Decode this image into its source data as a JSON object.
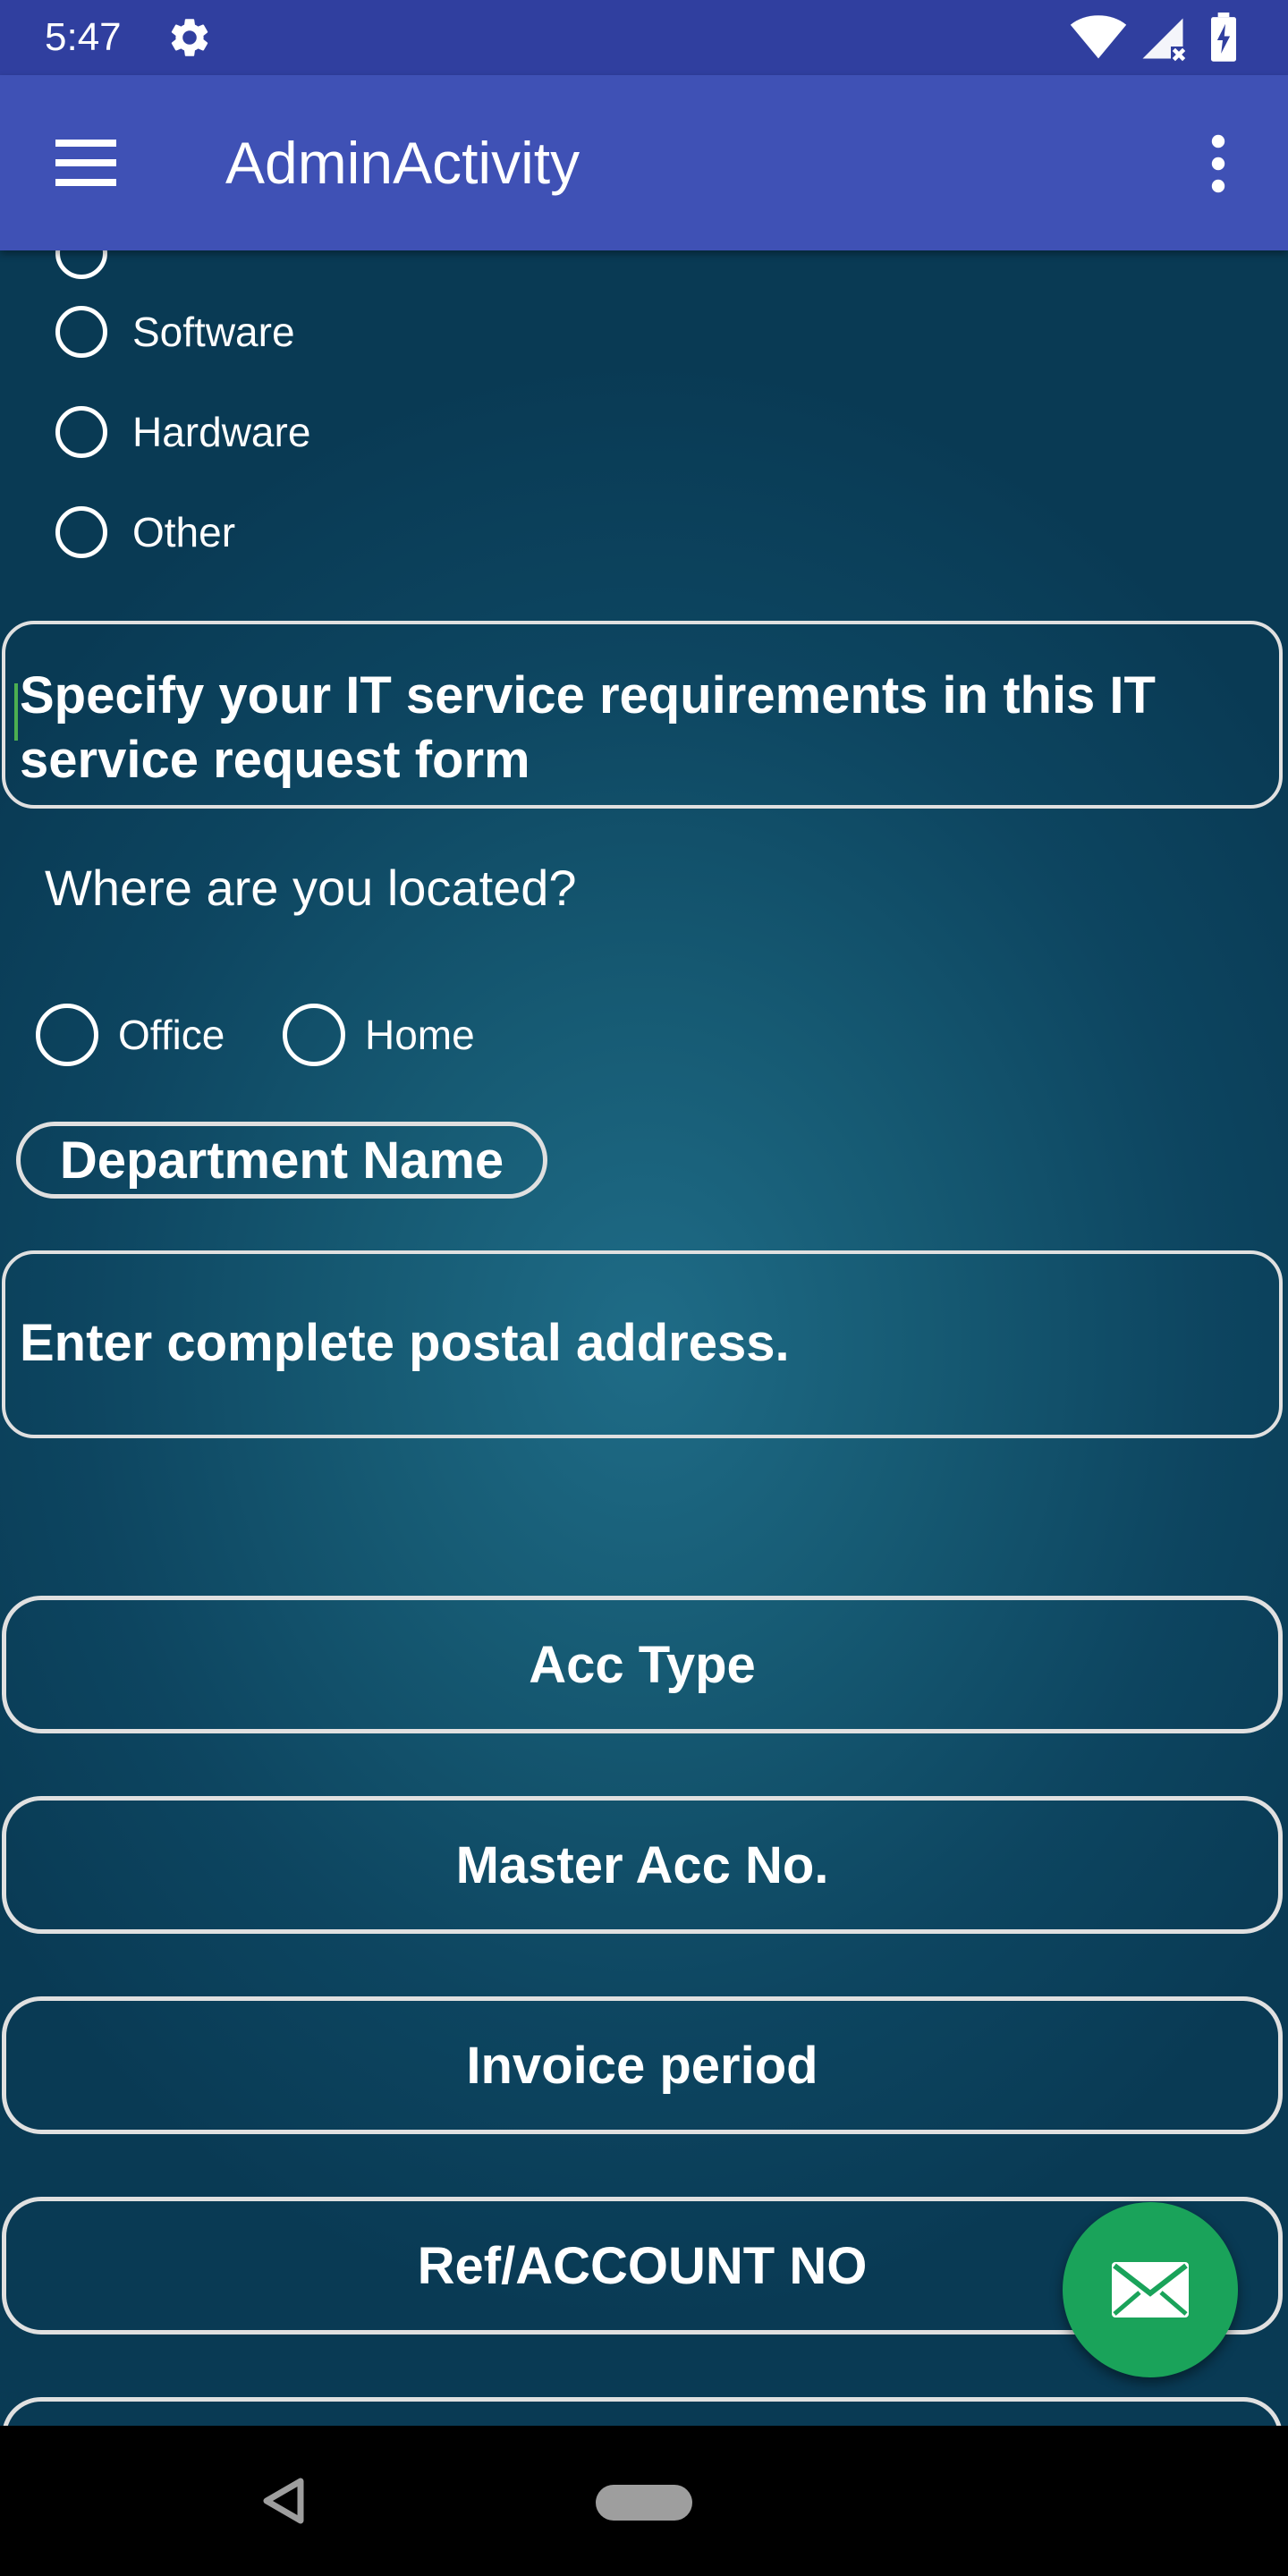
{
  "status_bar": {
    "time": "5:47",
    "icons": [
      "gear-icon",
      "wifi-icon",
      "signal-icon",
      "battery-icon"
    ]
  },
  "app_bar": {
    "title": "AdminActivity",
    "icons": [
      "menu-icon",
      "overflow-menu-icon"
    ],
    "color": "#3f51b5"
  },
  "category_options": [
    {
      "label": "Software",
      "selected": false
    },
    {
      "label": "Hardware",
      "selected": false
    },
    {
      "label": "Other",
      "selected": false
    }
  ],
  "requirements": {
    "value": "Specify your IT service requirements in this IT service request form"
  },
  "location": {
    "question": "Where are you located?",
    "options": [
      {
        "label": "Office",
        "selected": false
      },
      {
        "label": "Home",
        "selected": false
      }
    ]
  },
  "department": {
    "placeholder": "Department Name"
  },
  "address": {
    "placeholder": "Enter complete postal address."
  },
  "fields": [
    {
      "label": "Acc Type"
    },
    {
      "label": "Master Acc No."
    },
    {
      "label": "Invoice period"
    },
    {
      "label": "Ref/ACCOUNT NO"
    }
  ],
  "fab": {
    "icon": "mail-icon",
    "color": "#1aa35a"
  },
  "nav_bar": {
    "icons": [
      "back-icon",
      "home-pill"
    ]
  }
}
